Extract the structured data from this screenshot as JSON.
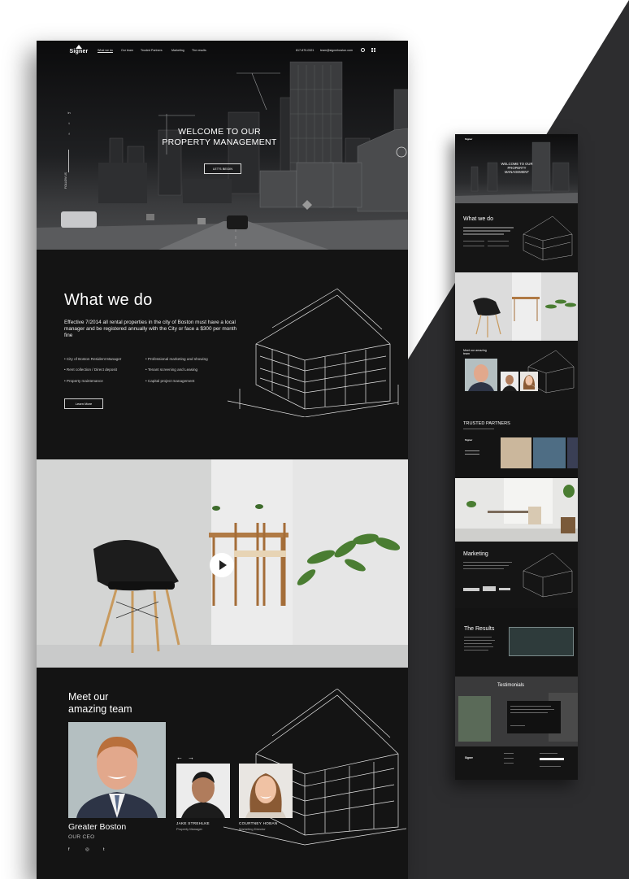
{
  "nav": {
    "logo": "Signer",
    "links": [
      "What we do",
      "Our team",
      "Trusted Partners",
      "Marketing",
      "The results"
    ],
    "phone": "617-870-0321",
    "email": "team@signerboston.com"
  },
  "hero": {
    "social": [
      "in",
      "t",
      "f"
    ],
    "follow_label": "FOLLOW US",
    "title_line1": "WELCOME TO OUR",
    "title_line2": "PROPERTY MANAGEMENT",
    "cta": "LET'S BEGIN"
  },
  "what_we_do": {
    "title": "What we do",
    "text": "Effective 7/2014 all rental properties in the city of Boston must have a local manager and be registered annually with the City or face a $300 per month fine",
    "list_left": [
      "City of Boston Resident Manager",
      "Rent collection / Direct deposit",
      "Property maintenance"
    ],
    "list_right": [
      "Professional marketing and showing",
      "Tenant screening and Leasing",
      "Capital project management"
    ],
    "button": "Learn More"
  },
  "team": {
    "title_line1": "Meet our",
    "title_line2": "amazing team",
    "ceo_name": "Greater Boston",
    "ceo_role": "OUR CEO",
    "ceo_social": [
      "f",
      "◎",
      "t"
    ],
    "members": [
      {
        "name": "JAKE STREHLKE",
        "role": "Property Manager"
      },
      {
        "name": "COURTNEY HOBAN",
        "role": "Marketing Director"
      }
    ]
  },
  "mini": {
    "hero_line1": "WELCOME TO OUR",
    "hero_line2": "PROPERTY MANAGEMENT",
    "what_we_do": "What we do",
    "team_title": "Meet our amazing team",
    "partners": "TRUSTED PARTNERS",
    "marketing": "Marketing",
    "results": "The Results",
    "testimonials": "Testimonials",
    "footer_logo": "Signer"
  },
  "colors": {
    "page_bg": "#ffffff",
    "wedge": "#2d2d2f",
    "panel": "#141414"
  }
}
